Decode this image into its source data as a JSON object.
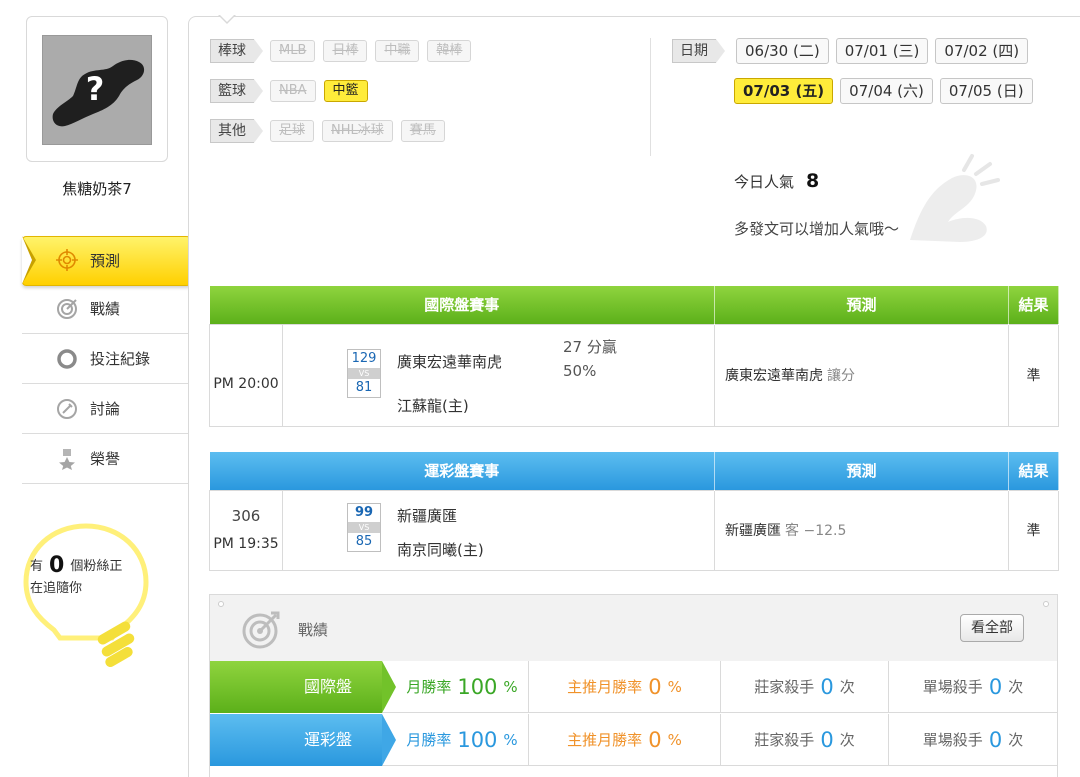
{
  "user": {
    "name": "焦糖奶茶7"
  },
  "sidebar": {
    "items": [
      {
        "label": "預測",
        "icon": "target-icon",
        "active": true
      },
      {
        "label": "戰績",
        "icon": "record-target-icon",
        "active": false
      },
      {
        "label": "投注紀錄",
        "icon": "ring-icon",
        "active": false
      },
      {
        "label": "討論",
        "icon": "discussion-icon",
        "active": false
      },
      {
        "label": "榮譽",
        "icon": "medal-icon",
        "active": false
      }
    ],
    "fans": {
      "prefix": "有",
      "count": "0",
      "suffix": "個粉絲正",
      "line2": "在追隨你"
    }
  },
  "filters": {
    "baseball": {
      "label": "棒球",
      "chips": [
        "MLB",
        "日棒",
        "中職",
        "韓棒"
      ]
    },
    "basketball": {
      "label": "籃球",
      "chips": [
        "NBA",
        "中籃"
      ],
      "active": "中籃"
    },
    "other": {
      "label": "其他",
      "chips": [
        "足球",
        "NHL冰球",
        "賽馬"
      ]
    }
  },
  "dates": {
    "label": "日期",
    "row1": [
      "06/30 (二)",
      "07/01 (三)",
      "07/02 (四)"
    ],
    "row2": [
      "07/03 (五)",
      "07/04 (六)",
      "07/05 (日)"
    ],
    "active": "07/03 (五)"
  },
  "popularity": {
    "label": "今日人氣",
    "value": "8",
    "hint": "多發文可以增加人氣哦～"
  },
  "international": {
    "headers": {
      "event": "國際盤賽事",
      "prediction": "預測",
      "result": "結果"
    },
    "match": {
      "time": "PM 20:00",
      "away_score": "129",
      "vs": "VS",
      "home_score": "81",
      "away_team": "廣東宏遠華南虎",
      "home_team": "江蘇龍(主)",
      "odds_line1": "27 分贏",
      "odds_line2": "50%",
      "prediction": "廣東宏遠華南虎",
      "prediction_note": "讓分",
      "result": "準"
    }
  },
  "lottery": {
    "headers": {
      "event": "運彩盤賽事",
      "prediction": "預測",
      "result": "結果"
    },
    "match": {
      "game_no": "306",
      "time": "PM 19:35",
      "away_score": "99",
      "vs": "VS",
      "home_score": "85",
      "away_team": "新疆廣匯",
      "home_team": "南京同曦(主)",
      "prediction": "新疆廣匯",
      "prediction_note": "客 −12.5",
      "result": "準"
    }
  },
  "record": {
    "title": "戰績",
    "see_all": "看全部",
    "rows": [
      {
        "tag": "國際盤",
        "color": "green",
        "monthly_label": "月勝率",
        "monthly_value": "100",
        "monthly_unit": "%",
        "main_label": "主推月勝率",
        "main_value": "0",
        "main_unit": "%",
        "banker_label": "莊家殺手",
        "banker_value": "0",
        "banker_unit": "次",
        "single_label": "單場殺手",
        "single_value": "0",
        "single_unit": "次"
      },
      {
        "tag": "運彩盤",
        "color": "blue",
        "monthly_label": "月勝率",
        "monthly_value": "100",
        "monthly_unit": "%",
        "main_label": "主推月勝率",
        "main_value": "0",
        "main_unit": "%",
        "banker_label": "莊家殺手",
        "banker_value": "0",
        "banker_unit": "次",
        "single_label": "單場殺手",
        "single_value": "0",
        "single_unit": "次"
      }
    ]
  },
  "colors": {
    "yellow": "#ffec3a",
    "green": "#5cb01a",
    "blue": "#2a98de",
    "orange": "#f0922a"
  }
}
